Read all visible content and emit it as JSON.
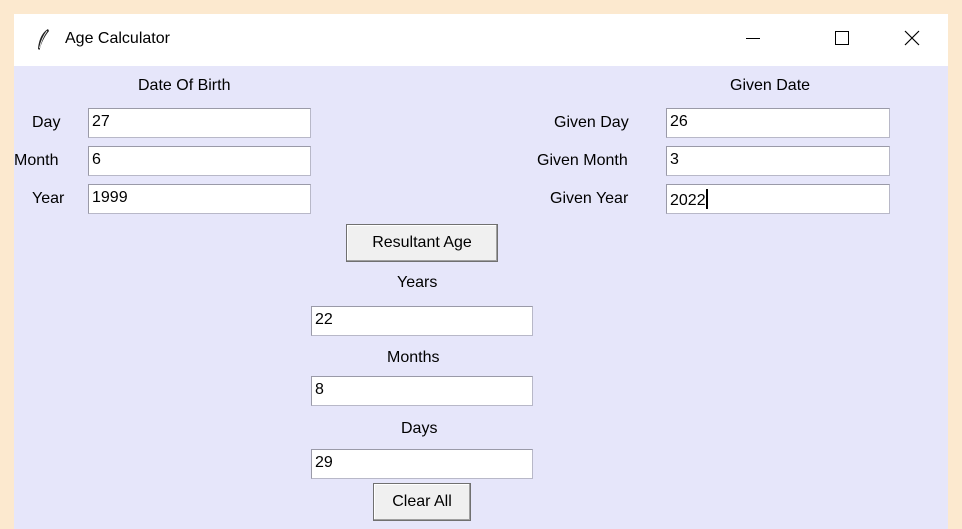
{
  "window": {
    "title": "Age Calculator",
    "app_icon": "feather-icon",
    "controls": [
      "minimize-icon",
      "maximize-icon",
      "close-icon"
    ]
  },
  "birth": {
    "heading": "Date Of Birth",
    "day_label": "Day",
    "day_value": "27",
    "month_label": "Month",
    "month_value": "6",
    "year_label": "Year",
    "year_value": "1999"
  },
  "given": {
    "heading": "Given Date",
    "day_label": "Given Day",
    "day_value": "26",
    "month_label": "Given Month",
    "month_value": "3",
    "year_label": "Given Year",
    "year_value": "2022"
  },
  "result": {
    "button_label": "Resultant Age",
    "years_label": "Years",
    "years_value": "22",
    "months_label": "Months",
    "months_value": "8",
    "days_label": "Days",
    "days_value": "29"
  },
  "actions": {
    "clear_label": "Clear All"
  },
  "colors": {
    "desktop": "#fce9cf",
    "client_bg": "#e6e6fa",
    "titlebar_bg": "#ffffff"
  }
}
